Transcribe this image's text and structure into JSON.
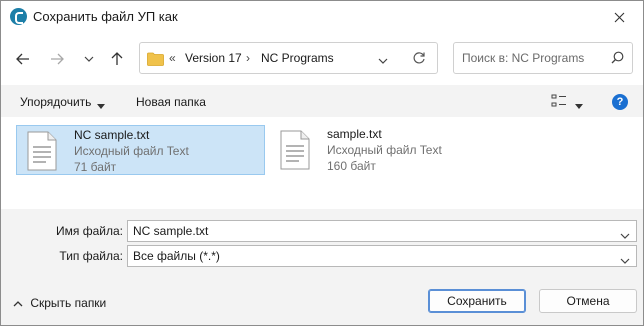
{
  "window": {
    "title": "Сохранить файл УП как"
  },
  "nav": {
    "breadcrumb_sep0": "«",
    "breadcrumb": [
      "Version 17",
      "NC Programs"
    ],
    "breadcrumb_sep": "›"
  },
  "search": {
    "placeholder": "Поиск в: NC Programs"
  },
  "toolbar": {
    "organize_label": "Упорядочить",
    "new_folder_label": "Новая папка",
    "help_label": "?"
  },
  "files": [
    {
      "name": "NC sample.txt",
      "type": "Исходный файл Text",
      "size": "71 байт",
      "selected": true
    },
    {
      "name": "sample.txt",
      "type": "Исходный файл Text",
      "size": "160 байт",
      "selected": false
    }
  ],
  "form": {
    "filename_label": "Имя файла:",
    "filename_value": "NC sample.txt",
    "filetype_label": "Тип файла:",
    "filetype_value": "Все файлы (*.*)"
  },
  "footer": {
    "hide_folders_label": "Скрыть папки",
    "save_label": "Сохранить",
    "cancel_label": "Отмена"
  },
  "colors": {
    "accent": "#1a6fd1",
    "selection": "#cce4f7",
    "folder": "#f0c24b"
  },
  "icons": [
    "app-icon",
    "close-icon",
    "back-arrow-icon",
    "forward-arrow-icon",
    "recent-locations-chevron-icon",
    "up-arrow-icon",
    "folder-icon",
    "dropdown-chevron-icon",
    "refresh-icon",
    "search-icon",
    "view-options-icon",
    "help-icon",
    "text-file-icon",
    "chevron-up-icon"
  ]
}
